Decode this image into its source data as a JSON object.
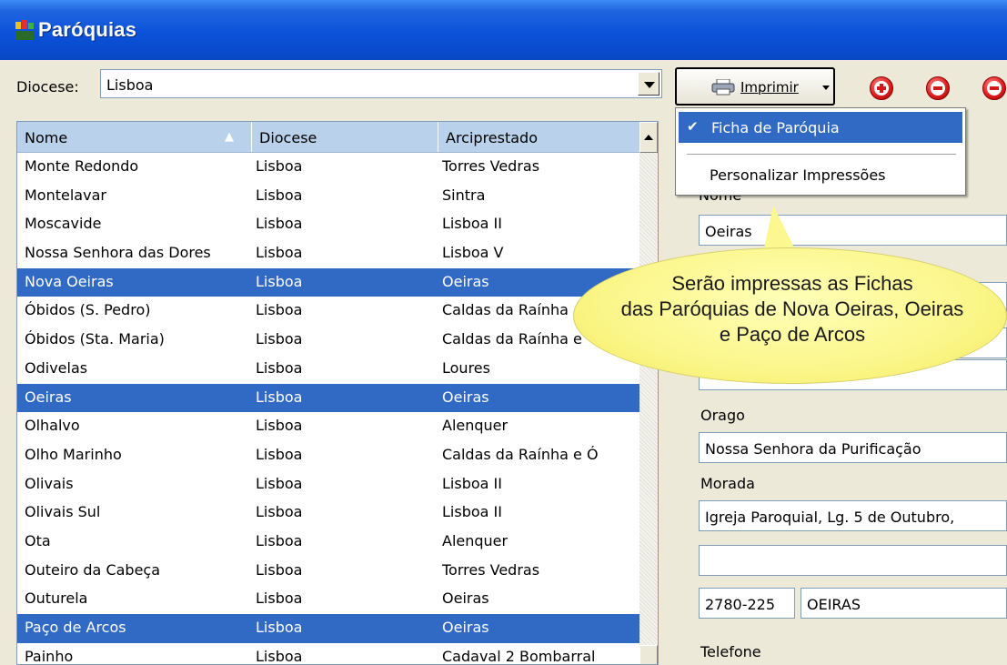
{
  "window": {
    "title": "Paróquias"
  },
  "filter": {
    "label": "Diocese:",
    "value": "Lisboa"
  },
  "grid": {
    "columns": [
      "Nome",
      "Diocese",
      "Arciprestado"
    ],
    "rows": [
      {
        "nome": "Monte Redondo",
        "diocese": "Lisboa",
        "arciprestado": "Torres Vedras",
        "selected": false
      },
      {
        "nome": "Montelavar",
        "diocese": "Lisboa",
        "arciprestado": "Sintra",
        "selected": false
      },
      {
        "nome": "Moscavide",
        "diocese": "Lisboa",
        "arciprestado": "Lisboa II",
        "selected": false
      },
      {
        "nome": "Nossa Senhora das Dores",
        "diocese": "Lisboa",
        "arciprestado": "Lisboa V",
        "selected": false
      },
      {
        "nome": "Nova Oeiras",
        "diocese": "Lisboa",
        "arciprestado": "Oeiras",
        "selected": true
      },
      {
        "nome": "Óbidos (S. Pedro)",
        "diocese": "Lisboa",
        "arciprestado": "Caldas da Raínha",
        "selected": false
      },
      {
        "nome": "Óbidos (Sta. Maria)",
        "diocese": "Lisboa",
        "arciprestado": "Caldas da Raínha e",
        "selected": false
      },
      {
        "nome": "Odivelas",
        "diocese": "Lisboa",
        "arciprestado": "Loures",
        "selected": false
      },
      {
        "nome": "Oeiras",
        "diocese": "Lisboa",
        "arciprestado": "Oeiras",
        "selected": true
      },
      {
        "nome": "Olhalvo",
        "diocese": "Lisboa",
        "arciprestado": "Alenquer",
        "selected": false
      },
      {
        "nome": "Olho Marinho",
        "diocese": "Lisboa",
        "arciprestado": "Caldas da Raínha e Ó",
        "selected": false
      },
      {
        "nome": "Olivais",
        "diocese": "Lisboa",
        "arciprestado": "Lisboa II",
        "selected": false
      },
      {
        "nome": "Olivais Sul",
        "diocese": "Lisboa",
        "arciprestado": "Lisboa II",
        "selected": false
      },
      {
        "nome": "Ota",
        "diocese": "Lisboa",
        "arciprestado": "Alenquer",
        "selected": false
      },
      {
        "nome": "Outeiro da Cabeça",
        "diocese": "Lisboa",
        "arciprestado": "Torres Vedras",
        "selected": false
      },
      {
        "nome": "Outurela",
        "diocese": "Lisboa",
        "arciprestado": "Oeiras",
        "selected": false
      },
      {
        "nome": "Paço de Arcos",
        "diocese": "Lisboa",
        "arciprestado": "Oeiras",
        "selected": true
      },
      {
        "nome": "Painho",
        "diocese": "Lisboa",
        "arciprestado": "Cadaval 2 Bombarral",
        "selected": false
      }
    ]
  },
  "toolbar": {
    "print_label": "Imprimir"
  },
  "print_menu": {
    "items": [
      {
        "label": "Ficha de Paróquia",
        "checked": true
      },
      {
        "label": "Personalizar Impressões",
        "checked": false
      }
    ]
  },
  "details": {
    "nome_label": "Nome",
    "nome_value": "Oeiras",
    "orago_label": "Orago",
    "orago_value": "Nossa Senhora da Purificação",
    "morada_label": "Morada",
    "morada_line1": "Igreja Paroquial, Lg. 5 de Outubro,",
    "morada_line2": "",
    "postal_code": "2780-225",
    "locality": "OEIRAS",
    "telefone_label": "Telefone"
  },
  "balloon": {
    "lines": [
      "Serão impressas as Fichas",
      "das Paróquias de Nova Oeiras, Oeiras",
      "e Paço de Arcos"
    ]
  },
  "colors": {
    "titlebar": "#0a50d8",
    "selection": "#316ac5",
    "balloon": "#fbf68a",
    "action_red": "#e02020"
  }
}
